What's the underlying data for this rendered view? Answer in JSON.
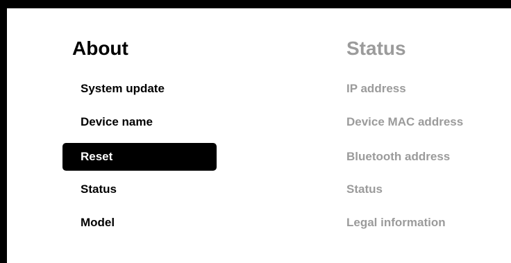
{
  "settings": {
    "left_title": "About",
    "menu_items": [
      {
        "label": "System update"
      },
      {
        "label": "Device name"
      },
      {
        "label": "Reset"
      },
      {
        "label": "Status"
      },
      {
        "label": "Model"
      }
    ],
    "selected_index": 2,
    "right_title": "Status",
    "status_items": [
      {
        "label": "IP address"
      },
      {
        "label": "Device MAC address"
      },
      {
        "label": "Bluetooth address"
      },
      {
        "label": "Status"
      },
      {
        "label": "Legal information"
      }
    ]
  },
  "colors": {
    "background": "#ffffff",
    "frame": "#000000",
    "selected_bg": "#000000",
    "selected_text": "#ffffff",
    "text": "#000000",
    "dimmed_text": "#9b9b9b"
  }
}
